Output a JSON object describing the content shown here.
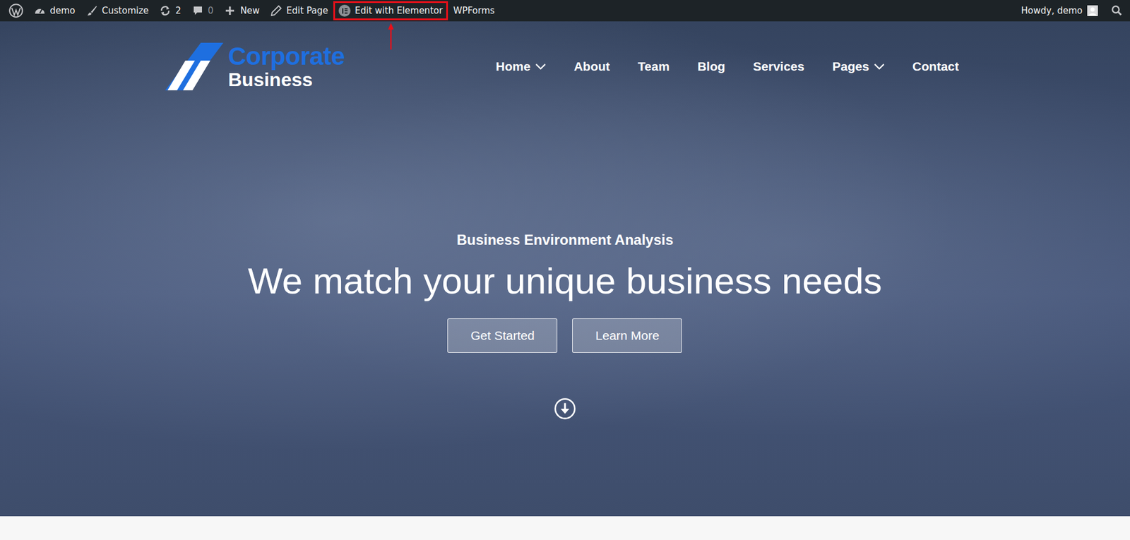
{
  "admin_bar": {
    "items": [
      {
        "kind": "logo",
        "label": "",
        "highlighted": false,
        "dimmed": false
      },
      {
        "kind": "site",
        "label": "demo",
        "highlighted": false,
        "dimmed": false
      },
      {
        "kind": "customize",
        "label": "Customize",
        "highlighted": false,
        "dimmed": false
      },
      {
        "kind": "updates",
        "label": "2",
        "highlighted": false,
        "dimmed": false
      },
      {
        "kind": "comments",
        "label": "0",
        "highlighted": false,
        "dimmed": true
      },
      {
        "kind": "new",
        "label": "New",
        "highlighted": false,
        "dimmed": false
      },
      {
        "kind": "edit",
        "label": "Edit Page",
        "highlighted": false,
        "dimmed": false
      },
      {
        "kind": "elementor",
        "label": "Edit with Elementor",
        "highlighted": true,
        "dimmed": false
      },
      {
        "kind": "plain",
        "label": "WPForms",
        "highlighted": false,
        "dimmed": false
      }
    ],
    "greeting": "Howdy, demo"
  },
  "site": {
    "logo_top": "Corporate",
    "logo_bottom": "Business",
    "nav": [
      {
        "label": "Home",
        "has_dropdown": true
      },
      {
        "label": "About",
        "has_dropdown": false
      },
      {
        "label": "Team",
        "has_dropdown": false
      },
      {
        "label": "Blog",
        "has_dropdown": false
      },
      {
        "label": "Services",
        "has_dropdown": false
      },
      {
        "label": "Pages",
        "has_dropdown": true
      },
      {
        "label": "Contact",
        "has_dropdown": false
      }
    ]
  },
  "hero": {
    "subtitle": "Business Environment Analysis",
    "title": "We match your unique business needs",
    "buttons": [
      "Get Started",
      "Learn More"
    ]
  }
}
